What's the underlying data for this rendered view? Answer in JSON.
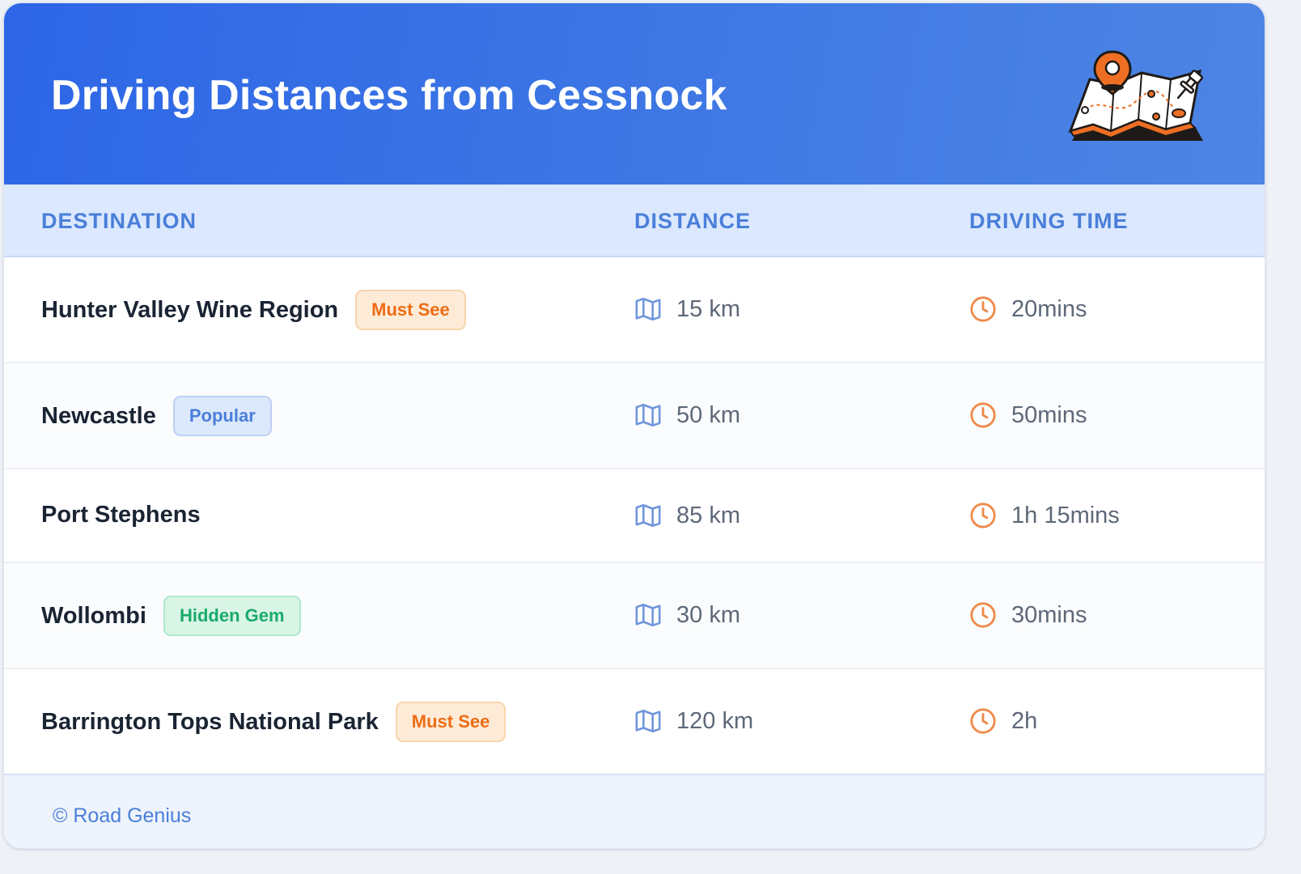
{
  "header": {
    "title": "Driving Distances from Cessnock"
  },
  "table": {
    "columns": [
      "DESTINATION",
      "DISTANCE",
      "DRIVING TIME"
    ],
    "rows": [
      {
        "destination": "Hunter Valley Wine Region",
        "badge": "Must See",
        "badge_type": "must-see",
        "distance": "15 km",
        "time": "20mins"
      },
      {
        "destination": "Newcastle",
        "badge": "Popular",
        "badge_type": "popular",
        "distance": "50 km",
        "time": "50mins"
      },
      {
        "destination": "Port Stephens",
        "badge": "",
        "badge_type": "none",
        "distance": "85 km",
        "time": "1h 15mins"
      },
      {
        "destination": "Wollombi",
        "badge": "Hidden Gem",
        "badge_type": "hidden-gem",
        "distance": "30 km",
        "time": "30mins"
      },
      {
        "destination": "Barrington Tops National Park",
        "badge": "Must See",
        "badge_type": "must-see",
        "distance": "120 km",
        "time": "2h"
      }
    ]
  },
  "icons": {
    "header": "map-pin-illustration-icon",
    "distance": "map-icon",
    "time": "clock-icon"
  },
  "colors": {
    "header_start": "#2d66e6",
    "header_end": "#4d85e4",
    "accent_blue": "#4a7fd9",
    "must_see": "#ec6c15",
    "popular": "#4a7fd9",
    "hidden_gem": "#1aab6a",
    "clock": "#ee8a4a"
  },
  "footer": {
    "text": "© Road Genius"
  }
}
